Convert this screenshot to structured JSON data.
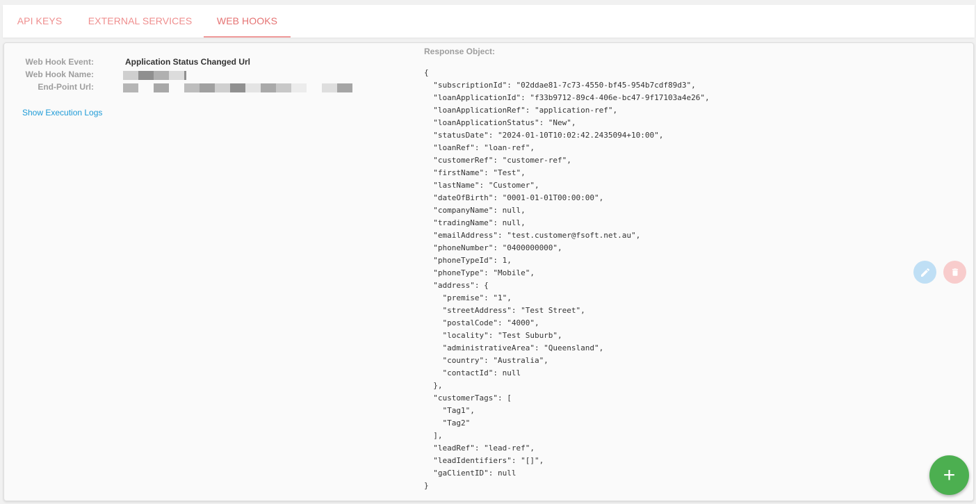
{
  "tabs": [
    {
      "label": "API KEYS",
      "active": false
    },
    {
      "label": "EXTERNAL SERVICES",
      "active": false
    },
    {
      "label": "WEB HOOKS",
      "active": true
    }
  ],
  "webhook": {
    "event_label": "Web Hook Event:",
    "event_value": "Application Status Changed Url",
    "name_label": "Web Hook Name:",
    "url_label": "End-Point Url:",
    "logs_link": "Show Execution Logs"
  },
  "response": {
    "title": "Response Object:",
    "json": "{\n  \"subscriptionId\": \"02ddae81-7c73-4550-bf45-954b7cdf89d3\",\n  \"loanApplicationId\": \"f33b9712-89c4-406e-bc47-9f17103a4e26\",\n  \"loanApplicationRef\": \"application-ref\",\n  \"loanApplicationStatus\": \"New\",\n  \"statusDate\": \"2024-01-10T10:02:42.2435094+10:00\",\n  \"loanRef\": \"loan-ref\",\n  \"customerRef\": \"customer-ref\",\n  \"firstName\": \"Test\",\n  \"lastName\": \"Customer\",\n  \"dateOfBirth\": \"0001-01-01T00:00:00\",\n  \"companyName\": null,\n  \"tradingName\": null,\n  \"emailAddress\": \"test.customer@fsoft.net.au\",\n  \"phoneNumber\": \"0400000000\",\n  \"phoneTypeId\": 1,\n  \"phoneType\": \"Mobile\",\n  \"address\": {\n    \"premise\": \"1\",\n    \"streetAddress\": \"Test Street\",\n    \"postalCode\": \"4000\",\n    \"locality\": \"Test Suburb\",\n    \"administrativeArea\": \"Queensland\",\n    \"country\": \"Australia\",\n    \"contactId\": null\n  },\n  \"customerTags\": [\n    \"Tag1\",\n    \"Tag2\"\n  ],\n  \"leadRef\": \"lead-ref\",\n  \"leadIdentifiers\": \"[]\",\n  \"gaClientID\": null\n}"
  },
  "actions": {
    "edit_icon": "pencil-icon",
    "delete_icon": "trash-icon",
    "add_label": "+"
  },
  "colors": {
    "tab_text": "#ef8f8f",
    "tab_underline": "#ef9a9a",
    "link": "#1e9bd7",
    "edit_button": "#bfdff5",
    "delete_button": "#f8cccc",
    "add_button": "#4caf50"
  }
}
